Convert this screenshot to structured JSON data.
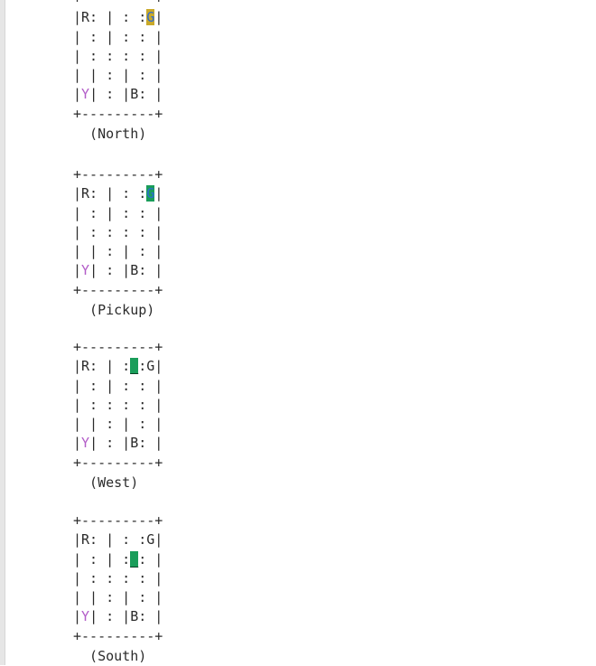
{
  "frames": [
    {
      "lines": [
        "+---------+",
        "|R: | : :G|",
        "| : | : : |",
        "| : : : : |",
        "| | : | : |",
        "|Y| : |B: |",
        "+---------+"
      ],
      "caption": "  (North)"
    },
    {
      "lines": [
        "+---------+",
        "|R: | : :G|",
        "| : | : : |",
        "| : : : : |",
        "| | : | : |",
        "|Y| : |B: |",
        "+---------+"
      ],
      "caption": "  (Pickup)"
    },
    {
      "lines": [
        "+---------+",
        "|R: | :_:G|",
        "| : | : : |",
        "| : : : : |",
        "| | : | : |",
        "|Y| : |B: |",
        "+---------+"
      ],
      "caption": "  (West)"
    },
    {
      "lines": [
        "+---------+",
        "|R: | : :G|",
        "| : | :_: |",
        "| : : : : |",
        "| | : | : |",
        "|Y| : |B: |",
        "+---------+"
      ],
      "caption": "  (South)"
    }
  ],
  "colors": {
    "yellow_highlight": "#c9a92a",
    "green_highlight": "#1a9d5a",
    "destination_letter": "#2e6bd6",
    "purple_letter": "#b25cc8"
  }
}
